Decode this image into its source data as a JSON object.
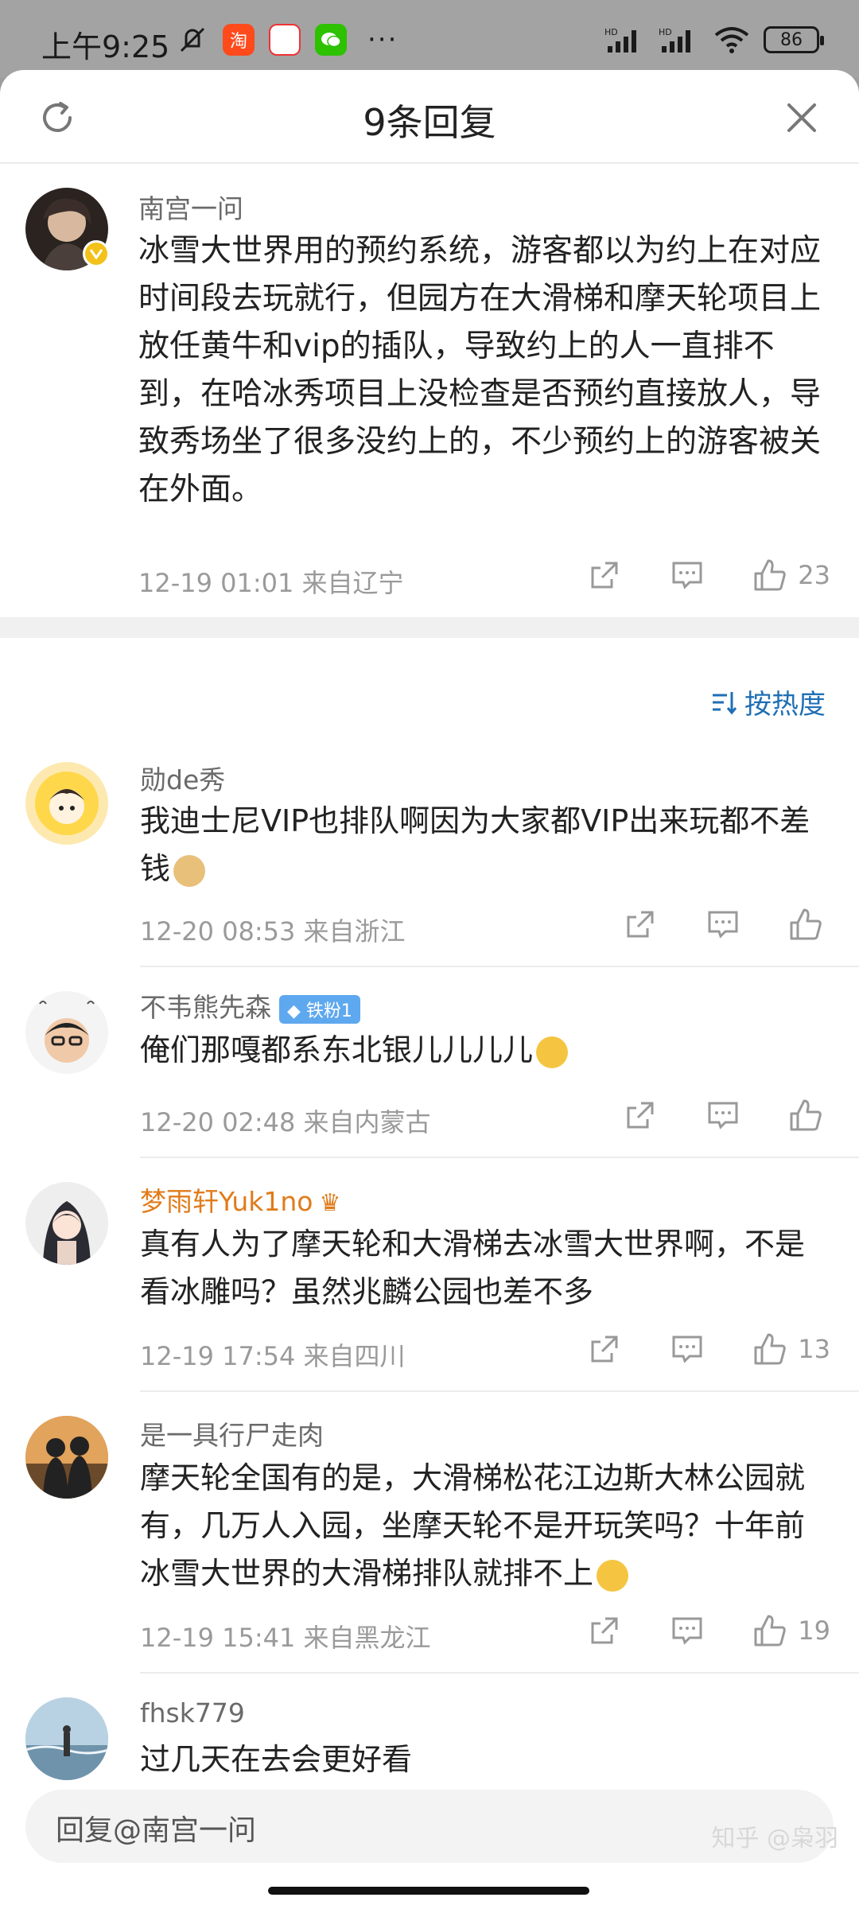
{
  "status": {
    "time": "上午9:25",
    "battery": "86",
    "net1": "HD",
    "net2": "HD"
  },
  "header": {
    "title": "9条回复"
  },
  "main_comment": {
    "author": "南宫一问",
    "text": "冰雪大世界用的预约系统，游客都以为约上在对应时间段去玩就行，但园方在大滑梯和摩天轮项目上放任黄牛和vip的插队，导致约上的人一直排不到，在哈冰秀项目上没检查是否预约直接放人，导致秀场坐了很多没约上的，不少预约上的游客被关在外面。",
    "meta": "12-19 01:01 来自辽宁",
    "likes": "23"
  },
  "sort_label": "按热度",
  "replies": [
    {
      "author": "勋de秀",
      "text": "我迪士尼VIP也排队啊因为大家都VIP出来玩都不差钱",
      "meta": "12-20 08:53 来自浙江",
      "likes": ""
    },
    {
      "author": "不韦熊先森",
      "badge": "铁粉1",
      "text": "俺们那嘎都系东北银儿儿儿儿",
      "meta": "12-20 02:48 来自内蒙古",
      "likes": ""
    },
    {
      "author": "梦雨轩Yuk1no",
      "text": "真有人为了摩天轮和大滑梯去冰雪大世界啊，不是看冰雕吗？虽然兆麟公园也差不多",
      "meta": "12-19 17:54 来自四川",
      "likes": "13"
    },
    {
      "author": "是一具行尸走肉",
      "text": "摩天轮全国有的是，大滑梯松花江边斯大林公园就有，几万人入园，坐摩天轮不是开玩笑吗？十年前冰雪大世界的大滑梯排队就排不上",
      "meta": "12-19 15:41 来自黑龙江",
      "likes": "19"
    },
    {
      "author": "fhsk779",
      "text": "过几天在去会更好看",
      "meta": "",
      "likes": ""
    }
  ],
  "reply_placeholder": "回复@南宫一问",
  "watermark": "知乎 @枭羽",
  "colors": {
    "accent": "#1f6fb5",
    "author_vip": "#e07b1a"
  }
}
